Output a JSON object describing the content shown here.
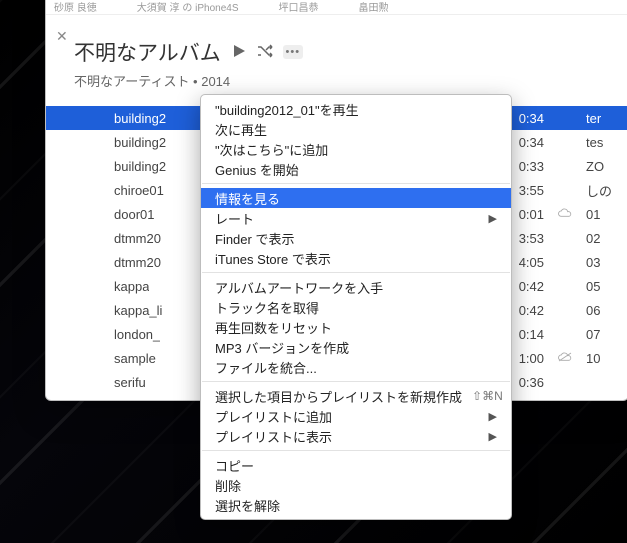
{
  "column_headers": [
    "砂原 良徳",
    "大須賀 淳 の iPhone4S",
    "坪口昌恭",
    "畠田勲"
  ],
  "album": {
    "title": "不明なアルバム",
    "subtitle": "不明なアーティスト • 2014"
  },
  "controls": {
    "play": "play-icon",
    "shuffle": "shuffle-icon",
    "more": "•••"
  },
  "tracks": [
    {
      "num": "",
      "name": "building2",
      "dur": "0:34",
      "cloud": "",
      "art": "ter",
      "selected": true
    },
    {
      "num": "",
      "name": "building2",
      "dur": "0:34",
      "cloud": "",
      "art": "tes",
      "selected": false
    },
    {
      "num": "",
      "name": "building2",
      "dur": "0:33",
      "cloud": "",
      "art": "ZO",
      "selected": false
    },
    {
      "num": "",
      "name": "chiroe01",
      "dur": "3:55",
      "cloud": "",
      "art": "しの",
      "selected": false
    },
    {
      "num": "",
      "name": "door01",
      "dur": "0:01",
      "cloud": "wait",
      "art": "01",
      "selected": false
    },
    {
      "num": "",
      "name": "dtmm20",
      "dur": "3:53",
      "cloud": "",
      "art": "02",
      "selected": false
    },
    {
      "num": "",
      "name": "dtmm20",
      "dur": "4:05",
      "cloud": "",
      "art": "03",
      "selected": false
    },
    {
      "num": "",
      "name": "kappa",
      "dur": "0:42",
      "cloud": "",
      "art": "05",
      "selected": false
    },
    {
      "num": "",
      "name": "kappa_li",
      "dur": "0:42",
      "cloud": "",
      "art": "06",
      "selected": false
    },
    {
      "num": "",
      "name": "london_",
      "dur": "0:14",
      "cloud": "",
      "art": "07",
      "selected": false
    },
    {
      "num": "",
      "name": "sample",
      "dur": "1:00",
      "cloud": "off",
      "art": "10",
      "selected": false
    },
    {
      "num": "",
      "name": "serifu",
      "dur": "0:36",
      "cloud": "",
      "art": "",
      "selected": false
    }
  ],
  "context_menu": [
    {
      "type": "item",
      "label": "\"building2012_01\"を再生"
    },
    {
      "type": "item",
      "label": "次に再生"
    },
    {
      "type": "item",
      "label": "\"次はこちら\"に追加"
    },
    {
      "type": "item",
      "label": "Genius を開始"
    },
    {
      "type": "sep"
    },
    {
      "type": "item",
      "label": "情報を見る",
      "highlight": true
    },
    {
      "type": "item",
      "label": "レート",
      "submenu": true
    },
    {
      "type": "item",
      "label": "Finder で表示"
    },
    {
      "type": "item",
      "label": "iTunes Store で表示"
    },
    {
      "type": "sep"
    },
    {
      "type": "item",
      "label": "アルバムアートワークを入手"
    },
    {
      "type": "item",
      "label": "トラック名を取得"
    },
    {
      "type": "item",
      "label": "再生回数をリセット"
    },
    {
      "type": "item",
      "label": "MP3 バージョンを作成"
    },
    {
      "type": "item",
      "label": "ファイルを統合..."
    },
    {
      "type": "sep"
    },
    {
      "type": "item",
      "label": "選択した項目からプレイリストを新規作成",
      "shortcut": "⇧⌘N"
    },
    {
      "type": "item",
      "label": "プレイリストに追加",
      "submenu": true
    },
    {
      "type": "item",
      "label": "プレイリストに表示",
      "submenu": true
    },
    {
      "type": "sep"
    },
    {
      "type": "item",
      "label": "コピー"
    },
    {
      "type": "item",
      "label": "削除"
    },
    {
      "type": "item",
      "label": "選択を解除"
    }
  ]
}
